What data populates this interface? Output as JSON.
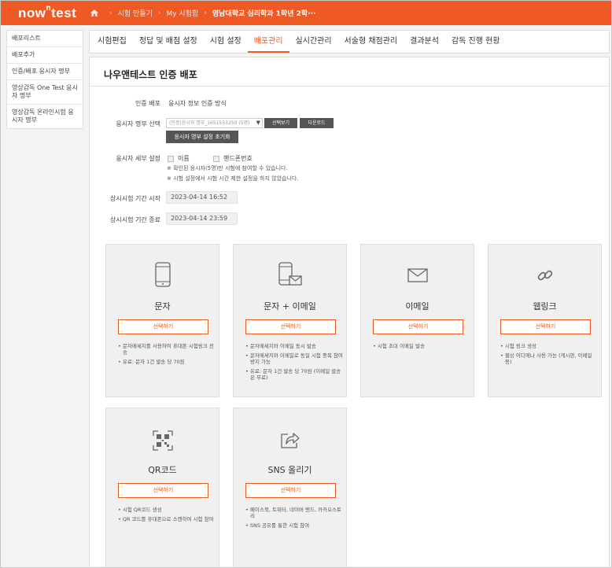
{
  "header": {
    "logo": "now",
    "logo_sup": "n",
    "logo_tail": "test",
    "breadcrumbs": [
      "시험 만들기",
      "My 시험함",
      "영남대학교 심리학과 1학년 2학···"
    ]
  },
  "sidebar": {
    "items": [
      "배포리스트",
      "배포추가",
      "인증/배포 응시자 명부",
      "영상감독 One Test 응시자 명부",
      "영상감독 온라인시험 응시자 명부"
    ]
  },
  "tabs": {
    "items": [
      "시험편집",
      "정답 및 배점 설정",
      "시험 설정",
      "배포관리",
      "실시간관리",
      "서술형 채점관리",
      "결과분석",
      "감독 진행 현황"
    ],
    "active_index": 3
  },
  "main": {
    "title": "나우앤테스트 인증 배포",
    "auth_label": "인증 배포",
    "auth_value": "응시자 정보 인증 방식",
    "roster_label": "응시자 명부 선택",
    "roster_select": "(인증)응시자 명부_1651553250 (5명)",
    "select_button": "선택보기",
    "download_button": "다운로드",
    "reset_button": "응시자 명부 설정 초기화",
    "detail_label": "응시자 세부 설정",
    "check_name": "이름",
    "check_phone": "핸드폰번호",
    "note1": "※ 확인된 응시자(5명)만 시험에 참여할 수 있습니다.",
    "note2": "※ 시험 설정에서 시험 시간 제한 설정을 하지 않았습니다.",
    "start_label": "상시시험 기간 시작",
    "start_value": "2023-04-14 16:52",
    "end_label": "상시시험 기간 종료",
    "end_value": "2023-04-14 23:59"
  },
  "cards": [
    {
      "title": "문자",
      "button": "선택하기",
      "icon": "mobile-phone-icon",
      "bullets": [
        "• 문자메세지를 사용하여 휴대폰 시험링크 전송",
        "• 유료: 문자 1건 발송 당 70원"
      ]
    },
    {
      "title": "문자 + 이메일",
      "button": "선택하기",
      "icon": "phone-mail-icon",
      "bullets": [
        "• 문자메세지와 이메일 동시 발송",
        "• 문자메세지와 이메일로 동일 시험 중복 참여 방지 가능",
        "• 유료: 문자 1건 발송 당 70원 (이메일 발송은 무료)"
      ]
    },
    {
      "title": "이메일",
      "button": "선택하기",
      "icon": "envelope-icon",
      "bullets": [
        "• 시험 초대 이메일 발송"
      ]
    },
    {
      "title": "웹링크",
      "button": "선택하기",
      "icon": "link-icon",
      "bullets": [
        "• 시험 링크 생성",
        "• 웹상 어디에나 사용 가능 (게시판, 이메일 등)"
      ]
    },
    {
      "title": "QR코드",
      "button": "선택하기",
      "icon": "qr-code-icon",
      "bullets": [
        "• 시험 QR코드 생성",
        "• QR 코드를 휴대폰으로 스캔하여 시험 참여"
      ]
    },
    {
      "title": "SNS 올리기",
      "button": "선택하기",
      "icon": "share-icon",
      "bullets": [
        "• 페이스북, 트위터, 네이버 밴드, 카카오스토리",
        "• SNS 공유를 통한 시험 참여"
      ]
    }
  ],
  "colors": {
    "accent": "#ef5a24",
    "card_bg": "#f0f0f0",
    "dark_button": "#555555"
  }
}
